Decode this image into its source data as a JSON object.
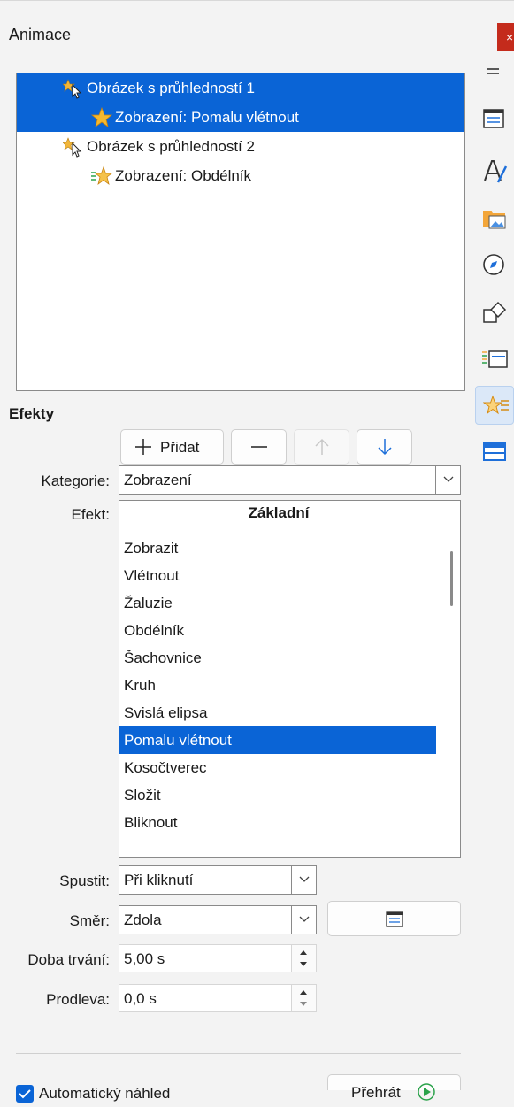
{
  "window": {
    "title": "Animace",
    "close_glyph": "×"
  },
  "animations": [
    {
      "label": "Obrázek s průhledností 1",
      "level": 0,
      "selected": true,
      "icon": "cursor-star-icon"
    },
    {
      "label": "Zobrazení: Pomalu vlétnout",
      "level": 1,
      "selected": true,
      "icon": "star-icon"
    },
    {
      "label": "Obrázek s průhledností 2",
      "level": 0,
      "selected": false,
      "icon": "cursor-star-icon"
    },
    {
      "label": "Zobrazení: Obdélník",
      "level": 1,
      "selected": false,
      "icon": "star-lines-icon"
    }
  ],
  "sidebar": {
    "items": [
      {
        "name": "menu-icon"
      },
      {
        "name": "properties-icon"
      },
      {
        "name": "styles-icon"
      },
      {
        "name": "gallery-icon"
      },
      {
        "name": "navigator-icon"
      },
      {
        "name": "shapes-icon"
      },
      {
        "name": "slide-transition-icon"
      },
      {
        "name": "animation-icon",
        "active": true
      },
      {
        "name": "master-slides-icon"
      }
    ]
  },
  "effects": {
    "section_title": "Efekty",
    "add_label": "Přidat",
    "category_label": "Kategorie:",
    "category_value": "Zobrazení",
    "effect_label": "Efekt:",
    "effect_header": "Základní",
    "effect_items": [
      "Zobrazit",
      "Vlétnout",
      "Žaluzie",
      "Obdélník",
      "Šachovnice",
      "Kruh",
      "Svislá elipsa",
      "Pomalu vlétnout",
      "Kosočtverec",
      "Složit",
      "Bliknout"
    ],
    "selected_effect": "Pomalu vlétnout",
    "start_label": "Spustit:",
    "start_value": "Při kliknutí",
    "direction_label": "Směr:",
    "direction_value": "Zdola",
    "duration_label": "Doba trvání:",
    "duration_value": "5,00 s",
    "delay_label": "Prodleva:",
    "delay_value": "0,0 s",
    "autopreview_label": "Automatický náhled",
    "autopreview_checked": true,
    "play_label": "Přehrát"
  },
  "colors": {
    "accent": "#0a64d6",
    "close": "#c42b1c"
  }
}
